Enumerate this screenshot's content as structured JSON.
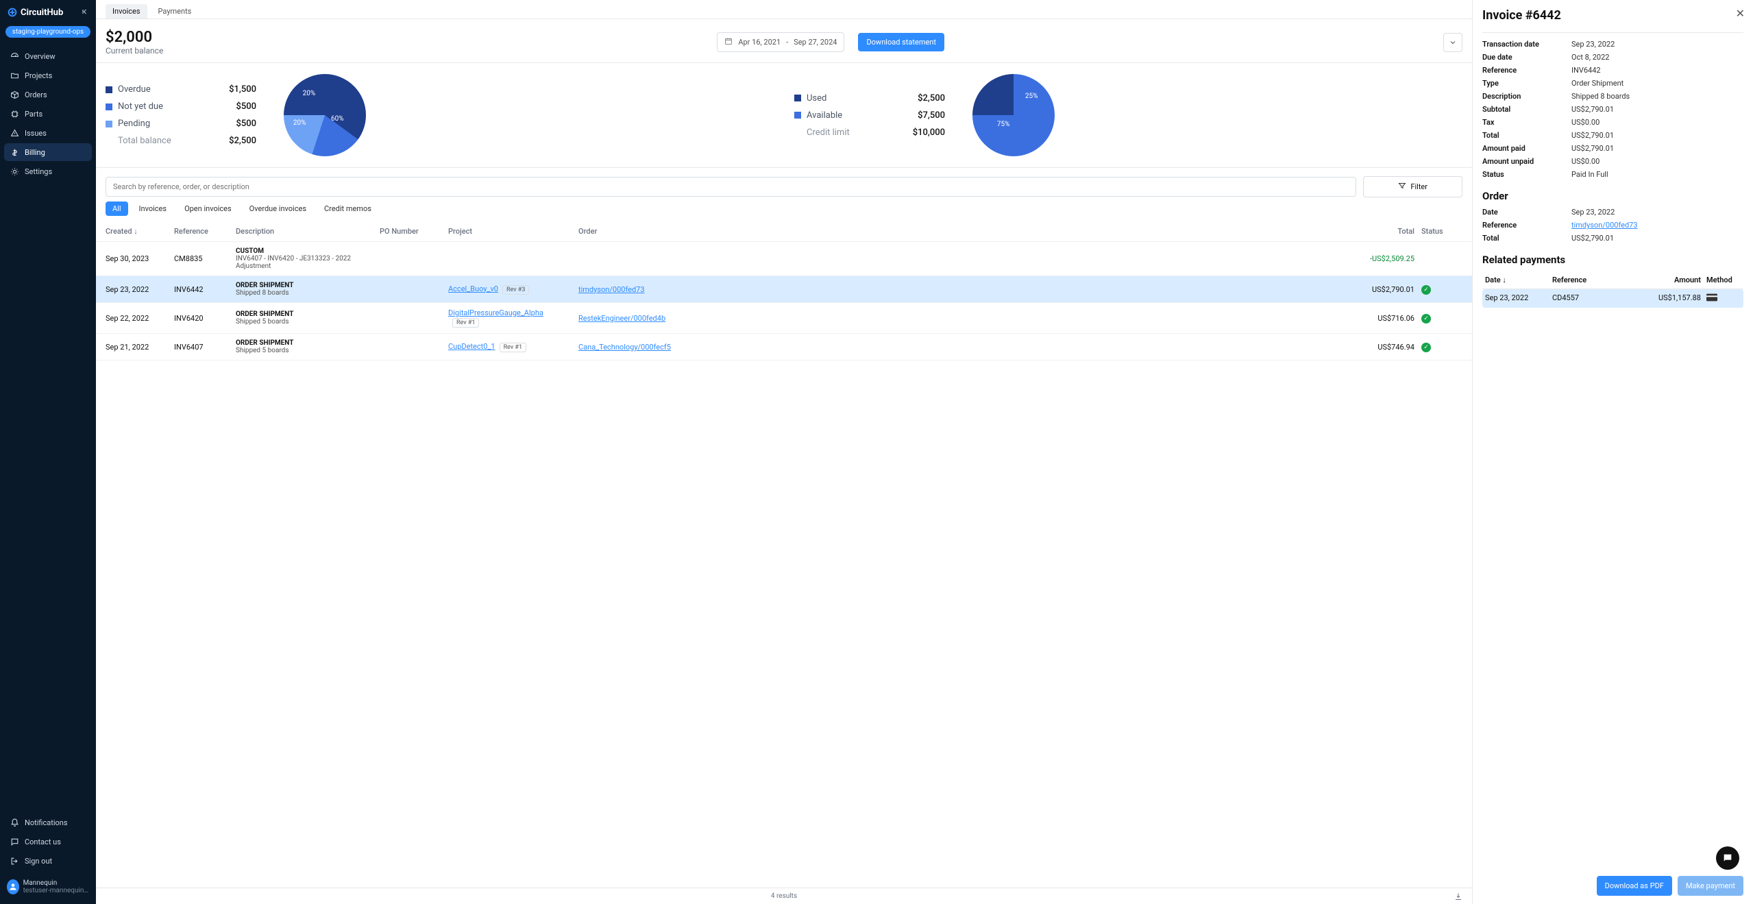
{
  "brand": {
    "name": "CircuitHub",
    "env_pill": "staging-playground-ops"
  },
  "nav": {
    "items": [
      {
        "icon": "gauge",
        "label": "Overview"
      },
      {
        "icon": "folder",
        "label": "Projects"
      },
      {
        "icon": "box",
        "label": "Orders"
      },
      {
        "icon": "chip",
        "label": "Parts"
      },
      {
        "icon": "alert",
        "label": "Issues"
      },
      {
        "icon": "dollar",
        "label": "Billing",
        "active": true
      },
      {
        "icon": "gear",
        "label": "Settings"
      }
    ],
    "footer": [
      {
        "icon": "bell",
        "label": "Notifications"
      },
      {
        "icon": "chat",
        "label": "Contact us"
      },
      {
        "icon": "signout",
        "label": "Sign out"
      }
    ]
  },
  "user": {
    "name": "Mannequin",
    "email": "testuser-mannequin@circ…"
  },
  "tabs": {
    "items": [
      "Invoices",
      "Payments"
    ],
    "active": 0
  },
  "balance": {
    "amount": "$2,000",
    "subtitle": "Current balance"
  },
  "date_range": {
    "from": "Apr 16, 2021",
    "to": "Sep 27, 2024"
  },
  "download_statement_label": "Download statement",
  "chart_data": [
    {
      "type": "pie",
      "title": "Balance breakdown",
      "series": [
        {
          "name": "Overdue",
          "value": 1500,
          "display": "$1,500",
          "pct": 60,
          "color": "#1f3e8c"
        },
        {
          "name": "Not yet due",
          "value": 500,
          "display": "$500",
          "pct": 20,
          "color": "#3b6fe0"
        },
        {
          "name": "Pending",
          "value": 500,
          "display": "$500",
          "pct": 20,
          "color": "#6ea2f5"
        }
      ],
      "footer": {
        "label": "Total balance",
        "value": "$2,500"
      }
    },
    {
      "type": "pie",
      "title": "Credit usage",
      "series": [
        {
          "name": "Used",
          "value": 2500,
          "display": "$2,500",
          "pct": 25,
          "color": "#1f3e8c"
        },
        {
          "name": "Available",
          "value": 7500,
          "display": "$7,500",
          "pct": 75,
          "color": "#3b6fe0"
        }
      ],
      "footer": {
        "label": "Credit limit",
        "value": "$10,000"
      }
    }
  ],
  "search_placeholder": "Search by reference, order, or description",
  "filter_label": "Filter",
  "chips": [
    "All",
    "Invoices",
    "Open invoices",
    "Overdue invoices",
    "Credit memos"
  ],
  "active_chip": 0,
  "columns": [
    "Created",
    "Reference",
    "Description",
    "PO Number",
    "Project",
    "Order",
    "Total",
    "Status"
  ],
  "rows": [
    {
      "created": "Sep 30, 2023",
      "reference": "CM8835",
      "desc_title": "CUSTOM",
      "desc_sub": "INV6407 - INV6420 - JE313323 - 2022 Adjustment",
      "project": "",
      "rev": "",
      "order": "",
      "total": "-US$2,509.25",
      "negative": true,
      "status": ""
    },
    {
      "created": "Sep 23, 2022",
      "reference": "INV6442",
      "desc_title": "ORDER SHIPMENT",
      "desc_sub": "Shipped 8 boards",
      "project": "Accel_Buoy_v0",
      "rev": "Rev #3",
      "order": "timdyson/000fed73",
      "total": "US$2,790.01",
      "status": "ok",
      "selected": true
    },
    {
      "created": "Sep 22, 2022",
      "reference": "INV6420",
      "desc_title": "ORDER SHIPMENT",
      "desc_sub": "Shipped 5 boards",
      "project": "DigitalPressureGauge_Alpha",
      "rev": "Rev #1",
      "order": "RestekEngineer/000fed4b",
      "total": "US$716.06",
      "status": "ok"
    },
    {
      "created": "Sep 21, 2022",
      "reference": "INV6407",
      "desc_title": "ORDER SHIPMENT",
      "desc_sub": "Shipped 5 boards",
      "project": "CupDetect0_1",
      "rev": "Rev #1",
      "order": "Cana_Technology/000fecf5",
      "total": "US$746.94",
      "status": "ok"
    }
  ],
  "results_count": "4 results",
  "drawer": {
    "title": "Invoice #6442",
    "details": [
      {
        "k": "Transaction date",
        "v": "Sep 23, 2022"
      },
      {
        "k": "Due date",
        "v": "Oct 8, 2022"
      },
      {
        "k": "Reference",
        "v": "INV6442"
      },
      {
        "k": "Type",
        "v": "Order Shipment"
      },
      {
        "k": "Description",
        "v": "Shipped 8 boards"
      },
      {
        "k": "Subtotal",
        "v": "US$2,790.01"
      },
      {
        "k": "Tax",
        "v": "US$0.00"
      },
      {
        "k": "Total",
        "v": "US$2,790.01"
      },
      {
        "k": "Amount paid",
        "v": "US$2,790.01"
      },
      {
        "k": "Amount unpaid",
        "v": "US$0.00"
      },
      {
        "k": "Status",
        "v": "Paid In Full"
      }
    ],
    "order_heading": "Order",
    "order_details": [
      {
        "k": "Date",
        "v": "Sep 23, 2022"
      },
      {
        "k": "Reference",
        "v": "timdyson/000fed73",
        "link": true
      },
      {
        "k": "Total",
        "v": "US$2,790.01"
      }
    ],
    "payments_heading": "Related payments",
    "payments_columns": [
      "Date",
      "Reference",
      "Amount",
      "Method"
    ],
    "payments": [
      {
        "date": "Sep 23, 2022",
        "reference": "CD4557",
        "amount": "US$1,157.88",
        "method": "card",
        "selected": true
      }
    ],
    "pdf_label": "Download as PDF",
    "pay_label": "Make payment"
  }
}
